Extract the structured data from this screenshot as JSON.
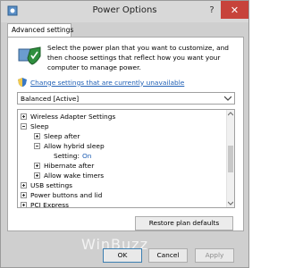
{
  "window": {
    "title": "Power Options",
    "help_label": "?",
    "close_label": "✕"
  },
  "tabs": [
    {
      "label": "Advanced settings"
    }
  ],
  "intro_text": "Select the power plan that you want to customize, and then choose settings that reflect how you want your computer to manage power.",
  "change_link": "Change settings that are currently unavailable",
  "plan": {
    "selected": "Balanced [Active]"
  },
  "tree": [
    {
      "label": "Wireless Adapter Settings",
      "expander": "plus"
    },
    {
      "label": "Sleep",
      "expander": "minus"
    },
    {
      "label": "Sleep after",
      "expander": "plus"
    },
    {
      "label": "Allow hybrid sleep",
      "expander": "minus"
    },
    {
      "label": "Setting:",
      "value": "On"
    },
    {
      "label": "Hibernate after",
      "expander": "plus"
    },
    {
      "label": "Allow wake timers",
      "expander": "plus"
    },
    {
      "label": "USB settings",
      "expander": "plus"
    },
    {
      "label": "Power buttons and lid",
      "expander": "plus"
    },
    {
      "label": "PCI Express",
      "expander": "plus"
    }
  ],
  "restore_label": "Restore plan defaults",
  "buttons": {
    "ok": "OK",
    "cancel": "Cancel",
    "apply": "Apply"
  },
  "watermark": "WinBuzz",
  "colors": {
    "link": "#1f5fb5",
    "close": "#c7433b",
    "shield": "#2f8f3f"
  }
}
